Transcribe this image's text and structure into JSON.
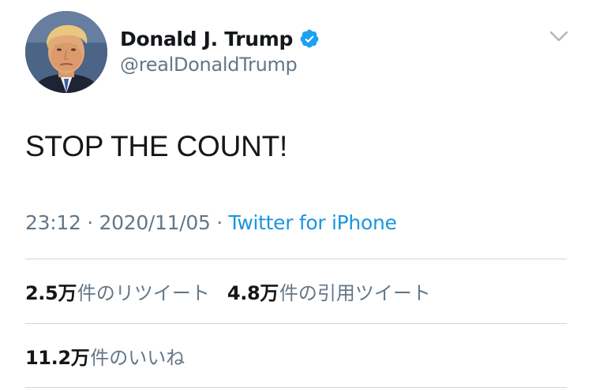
{
  "user": {
    "display_name": "Donald J. Trump",
    "handle": "@realDonaldTrump",
    "verified_icon": "verified-badge-icon",
    "avatar_icon": "profile-photo"
  },
  "menu": {
    "icon": "chevron-down-icon"
  },
  "tweet": {
    "text": "STOP THE COUNT!",
    "time": "23:12",
    "separator": " · ",
    "date": "2020/11/05",
    "source": "Twitter for iPhone"
  },
  "stats": {
    "retweets": {
      "count": "2.5万",
      "label": "件のリツイート"
    },
    "quotes": {
      "count": "4.8万",
      "label": "件の引用ツイート"
    },
    "likes": {
      "count": "11.2万",
      "label": "件のいいね"
    }
  },
  "colors": {
    "text": "#14171a",
    "secondary": "#657786",
    "link": "#1b95e0",
    "verified": "#1da1f2",
    "divider": "#ccd6dd"
  }
}
